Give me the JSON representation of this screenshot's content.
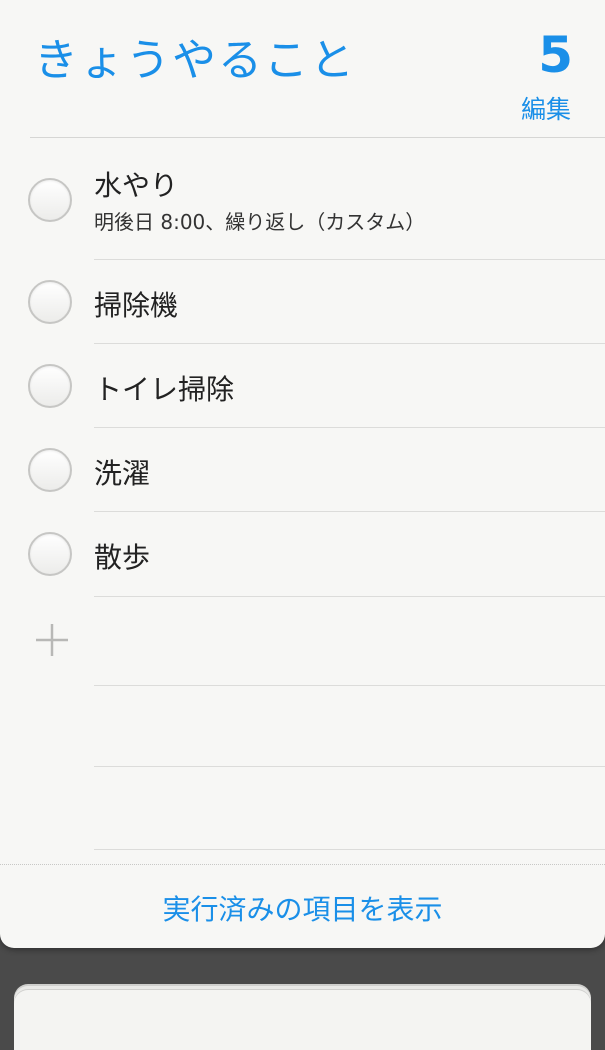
{
  "header": {
    "title": "きょうやること",
    "count": "5",
    "edit_label": "編集"
  },
  "tasks": [
    {
      "title": "水やり",
      "subtitle": "明後日 8:00、繰り返し（カスタム）"
    },
    {
      "title": "掃除機"
    },
    {
      "title": "トイレ掃除"
    },
    {
      "title": "洗濯"
    },
    {
      "title": "散歩"
    }
  ],
  "footer": {
    "show_completed_label": "実行済みの項目を表示"
  },
  "colors": {
    "accent": "#1a8fe8",
    "background": "#f7f7f5",
    "backdrop": "#4a4a4a"
  },
  "icons": {
    "add": "plus-icon",
    "checkbox": "circle-checkbox-icon"
  }
}
